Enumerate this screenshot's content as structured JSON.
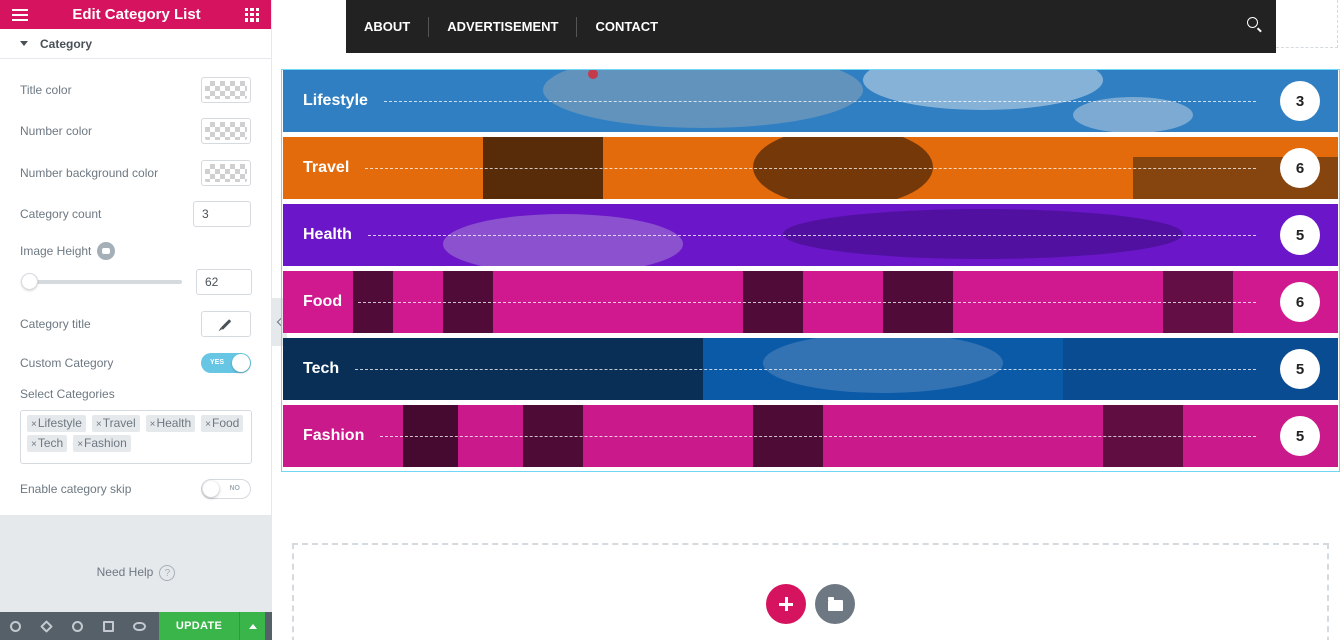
{
  "panel": {
    "title": "Edit Category List",
    "section_title": "Category",
    "controls": {
      "title_color_label": "Title color",
      "number_color_label": "Number color",
      "number_bg_color_label": "Number background color",
      "category_count_label": "Category count",
      "category_count_value": "3",
      "image_height_label": "Image Height",
      "image_height_value": "62",
      "category_title_label": "Category title",
      "custom_category_label": "Custom Category",
      "custom_category_toggle": "YES",
      "select_categories_label": "Select Categories",
      "selected_categories": [
        "Lifestyle",
        "Travel",
        "Health",
        "Food",
        "Tech",
        "Fashion"
      ],
      "enable_skip_label": "Enable category skip",
      "enable_skip_toggle": "NO"
    },
    "need_help": "Need Help",
    "footer": {
      "update_label": "UPDATE"
    }
  },
  "nav": {
    "items": [
      "ABOUT",
      "ADVERTISEMENT",
      "CONTACT"
    ]
  },
  "categories": [
    {
      "name": "Lifestyle",
      "count": "3",
      "color": "#2f7fc2"
    },
    {
      "name": "Travel",
      "count": "6",
      "color": "#e36b0c"
    },
    {
      "name": "Health",
      "count": "5",
      "color": "#6b17c9"
    },
    {
      "name": "Food",
      "count": "6",
      "color": "#d0198f"
    },
    {
      "name": "Tech",
      "count": "5",
      "color": "#0b5aa8"
    },
    {
      "name": "Fashion",
      "count": "5",
      "color": "#c9198a"
    }
  ],
  "colors": {
    "accent": "#d5135f",
    "update_green": "#39b54a",
    "selected_outline": "#71d7f7"
  }
}
